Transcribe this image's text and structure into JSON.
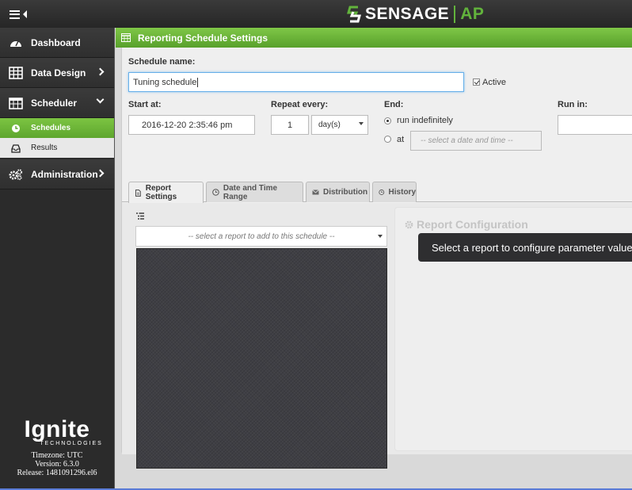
{
  "brand": {
    "name": "SENSAGE",
    "suffix": "AP"
  },
  "sidebar": {
    "items": [
      {
        "label": "Dashboard",
        "icon": "dashboard-icon"
      },
      {
        "label": "Data Design",
        "icon": "grid-icon",
        "chevron": "right"
      },
      {
        "label": "Scheduler",
        "icon": "calendar-icon",
        "chevron": "down",
        "children": [
          {
            "label": "Schedules",
            "icon": "clock-icon",
            "active": true
          },
          {
            "label": "Results",
            "icon": "inbox-icon",
            "active": false
          }
        ]
      },
      {
        "label": "Administration",
        "icon": "gears-icon",
        "chevron": "right"
      }
    ],
    "footer": {
      "logo": "Ignite",
      "logo_sub": "TECHNOLOGIES",
      "timezone": "Timezone: UTC",
      "version": "Version: 6.3.0",
      "release": "Release: 1481091296.el6"
    }
  },
  "panel": {
    "title": "Reporting Schedule Settings",
    "schedule_name_label": "Schedule name:",
    "schedule_name_value": "Tuning schedule",
    "active_label": "Active",
    "active_checked": true,
    "start_label": "Start at:",
    "start_value": "2016-12-20 2:35:46 pm",
    "repeat_label": "Repeat every:",
    "repeat_value": "1",
    "repeat_unit": "day(s)",
    "end_label": "End:",
    "end_option_indef": "run indefinitely",
    "end_option_at": "at",
    "end_at_placeholder": "-- select a date and time --",
    "runin_label": "Run in:",
    "runin_value": ""
  },
  "tabs": [
    {
      "label": "Report Settings",
      "icon": "document-icon",
      "active": true
    },
    {
      "label": "Date and Time Range",
      "icon": "clock-icon",
      "active": false
    },
    {
      "label": "Distribution",
      "icon": "envelope-icon",
      "active": false
    },
    {
      "label": "History",
      "icon": "history-icon",
      "active": false
    }
  ],
  "report_tab": {
    "select_placeholder": "-- select a report to add to this schedule --",
    "config_title": "Report Configuration",
    "tooltip": "Select a report to configure parameter values"
  },
  "colors": {
    "accent_green": "#62b33c",
    "topbar": "#2b2b2b",
    "tooltip_bg": "#2e2e30"
  }
}
